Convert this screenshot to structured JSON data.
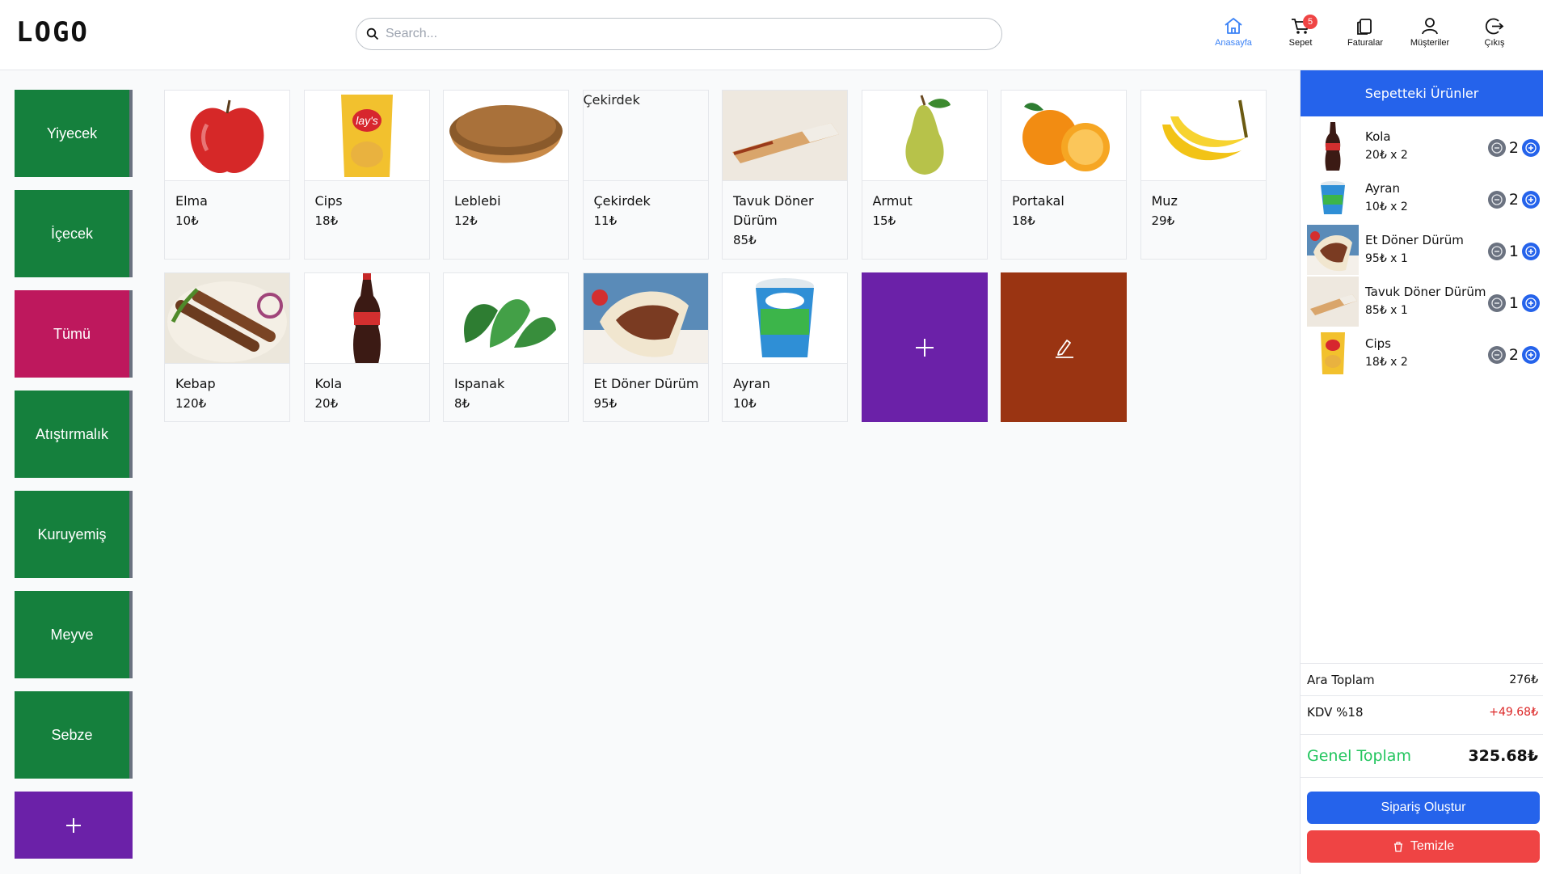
{
  "header": {
    "logo": "LOGO",
    "search_placeholder": "Search...",
    "nav": [
      {
        "label": "Anasayfa",
        "icon": "home-icon",
        "active": true
      },
      {
        "label": "Sepet",
        "icon": "cart-icon",
        "badge": "5"
      },
      {
        "label": "Faturalar",
        "icon": "invoice-icon"
      },
      {
        "label": "Müşteriler",
        "icon": "user-icon"
      },
      {
        "label": "Çıkış",
        "icon": "logout-icon"
      }
    ]
  },
  "categories": [
    "Yiyecek",
    "İçecek",
    "Tümü",
    "Atıştırmalık",
    "Kuruyemiş",
    "Meyve",
    "Sebze"
  ],
  "active_category": "Tümü",
  "products": [
    {
      "name": "Elma",
      "price": "10₺"
    },
    {
      "name": "Cips",
      "price": "18₺"
    },
    {
      "name": "Leblebi",
      "price": "12₺"
    },
    {
      "name": "Çekirdek",
      "price": "11₺",
      "image_alt": "Çekirdek"
    },
    {
      "name": "Tavuk Döner Dürüm",
      "price": "85₺"
    },
    {
      "name": "Armut",
      "price": "15₺"
    },
    {
      "name": "Portakal",
      "price": "18₺"
    },
    {
      "name": "Muz",
      "price": "29₺"
    },
    {
      "name": "Kebap",
      "price": "120₺"
    },
    {
      "name": "Kola",
      "price": "20₺"
    },
    {
      "name": "Ispanak",
      "price": "8₺"
    },
    {
      "name": "Et Döner Dürüm",
      "price": "95₺"
    },
    {
      "name": "Ayran",
      "price": "10₺"
    }
  ],
  "cart": {
    "title": "Sepetteki Ürünler",
    "items": [
      {
        "name": "Kola",
        "line": "20₺ x 2",
        "qty": "2"
      },
      {
        "name": "Ayran",
        "line": "10₺ x 2",
        "qty": "2"
      },
      {
        "name": "Et Döner Dürüm",
        "line": "95₺ x 1",
        "qty": "1"
      },
      {
        "name": "Tavuk Döner Dürüm",
        "line": "85₺ x 1",
        "qty": "1"
      },
      {
        "name": "Cips",
        "line": "18₺ x 2",
        "qty": "2"
      }
    ],
    "subtotal_label": "Ara Toplam",
    "subtotal": "276₺",
    "tax_label": "KDV %18",
    "tax": "+49.68₺",
    "total_label": "Genel Toplam",
    "total": "325.68₺",
    "order_button": "Sipariş Oluştur",
    "clear_button": "Temizle"
  },
  "colors": {
    "category": "#15803d",
    "category_active": "#be185d",
    "add": "#6b21a8",
    "edit": "#9a3412",
    "primary": "#2563eb",
    "danger": "#ef4444",
    "total": "#22c55e"
  }
}
